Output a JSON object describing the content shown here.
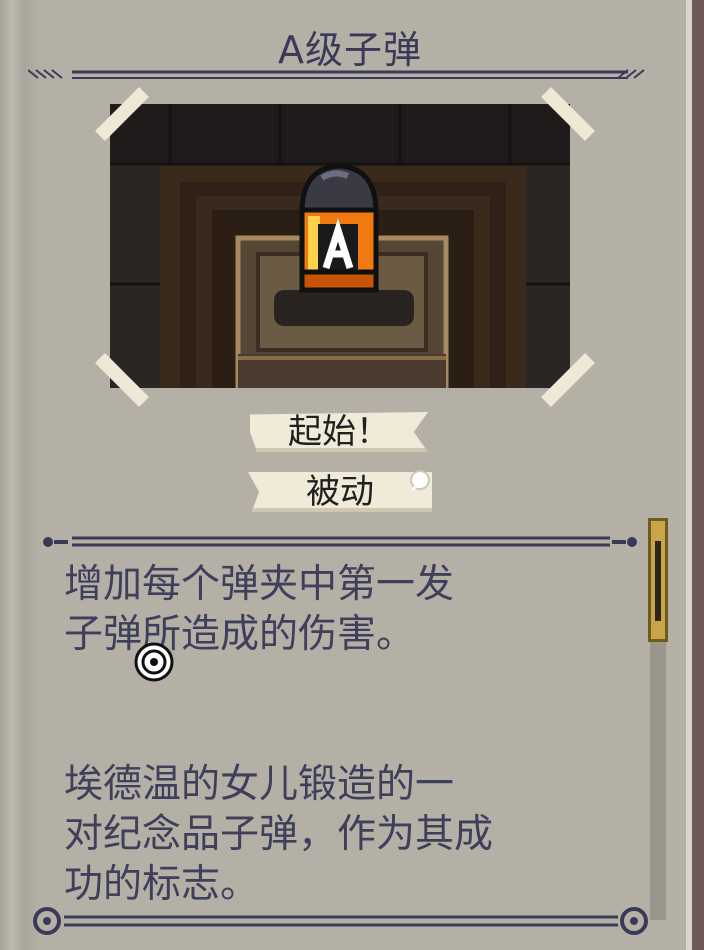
{
  "item": {
    "title": "A级子弹",
    "tags": [
      "起始！",
      "被动"
    ],
    "description": [
      "增加每个弹夹中第一发",
      "子弹所造成的伤害。"
    ],
    "lore": [
      "埃德温的女儿锻造的一",
      "对纪念品子弹，作为其成"
    ],
    "lore_cutoff": "功的标志。"
  },
  "icons": {
    "item_sprite": "bullet-a-icon",
    "cursor": "reticle-cursor-icon",
    "unread_marker": "speech-bubble-icon"
  },
  "colors": {
    "page": "#b4b0a6",
    "text": "#3f3f5c",
    "bullet_orange": "#f07a10",
    "bullet_yellow": "#f6c020",
    "badge": "#f0ead8"
  }
}
